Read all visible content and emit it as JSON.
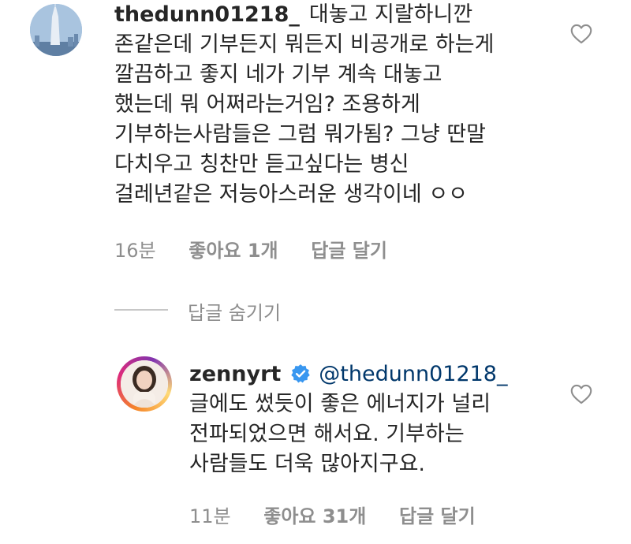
{
  "comments": [
    {
      "username": "thedunn01218_",
      "lines": [
        "대놓고 지랄하니깐",
        "존같은데 기부든지 뭐든지 비공개로 하는게",
        "깔끔하고 좋지 네가 기부 계속 대놓고",
        "했는데 뭐 어쩌라는거임? 조용하게",
        "기부하는사람들은 그럼 뭐가됨? 그냥 딴말",
        "다치우고 칭찬만 듣고싶다는 병신",
        "걸레년같은 저능아스러운 생각이네 ㅇㅇ"
      ],
      "time": "16분",
      "likes": "좋아요 1개",
      "reply": "답글 달기"
    },
    {
      "username": "zennyrt",
      "mention": "@thedunn01218_",
      "lines": [
        "글에도 썼듯이 좋은 에너지가 널리",
        "전파되었으면 해서요. 기부하는",
        "사람들도 더욱 많아지구요."
      ],
      "time": "11분",
      "likes": "좋아요 31개",
      "reply": "답글 달기"
    }
  ],
  "hide_replies": "답글 숨기기",
  "icons": {
    "heart": "heart-outline-icon",
    "verified": "verified-badge-icon"
  },
  "colors": {
    "text": "#262626",
    "muted": "#8e8e8e",
    "mention": "#00376b",
    "verified": "#3897f0"
  }
}
